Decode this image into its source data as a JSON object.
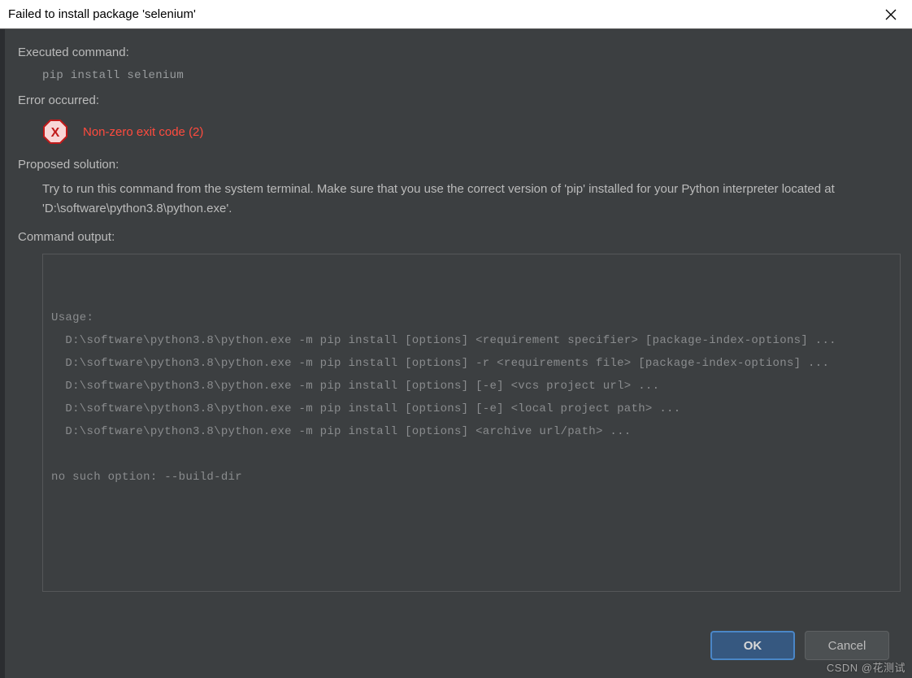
{
  "title": "Failed to install package 'selenium'",
  "sections": {
    "executed_label": "Executed command:",
    "executed_cmd": "pip install selenium",
    "error_label": "Error occurred:",
    "error_msg": "Non-zero exit code (2)",
    "solution_label": "Proposed solution:",
    "solution_text": "Try to run this command from the system terminal. Make sure that you use the correct version of 'pip' installed for your Python interpreter located at 'D:\\software\\python3.8\\python.exe'.",
    "output_label": "Command output:",
    "output_text": "\n\nUsage:\n  D:\\software\\python3.8\\python.exe -m pip install [options] <requirement specifier> [package-index-options] ...\n  D:\\software\\python3.8\\python.exe -m pip install [options] -r <requirements file> [package-index-options] ...\n  D:\\software\\python3.8\\python.exe -m pip install [options] [-e] <vcs project url> ...\n  D:\\software\\python3.8\\python.exe -m pip install [options] [-e] <local project path> ...\n  D:\\software\\python3.8\\python.exe -m pip install [options] <archive url/path> ...\n\nno such option: --build-dir"
  },
  "buttons": {
    "ok": "OK",
    "cancel": "Cancel"
  },
  "watermark": "CSDN @花测试"
}
